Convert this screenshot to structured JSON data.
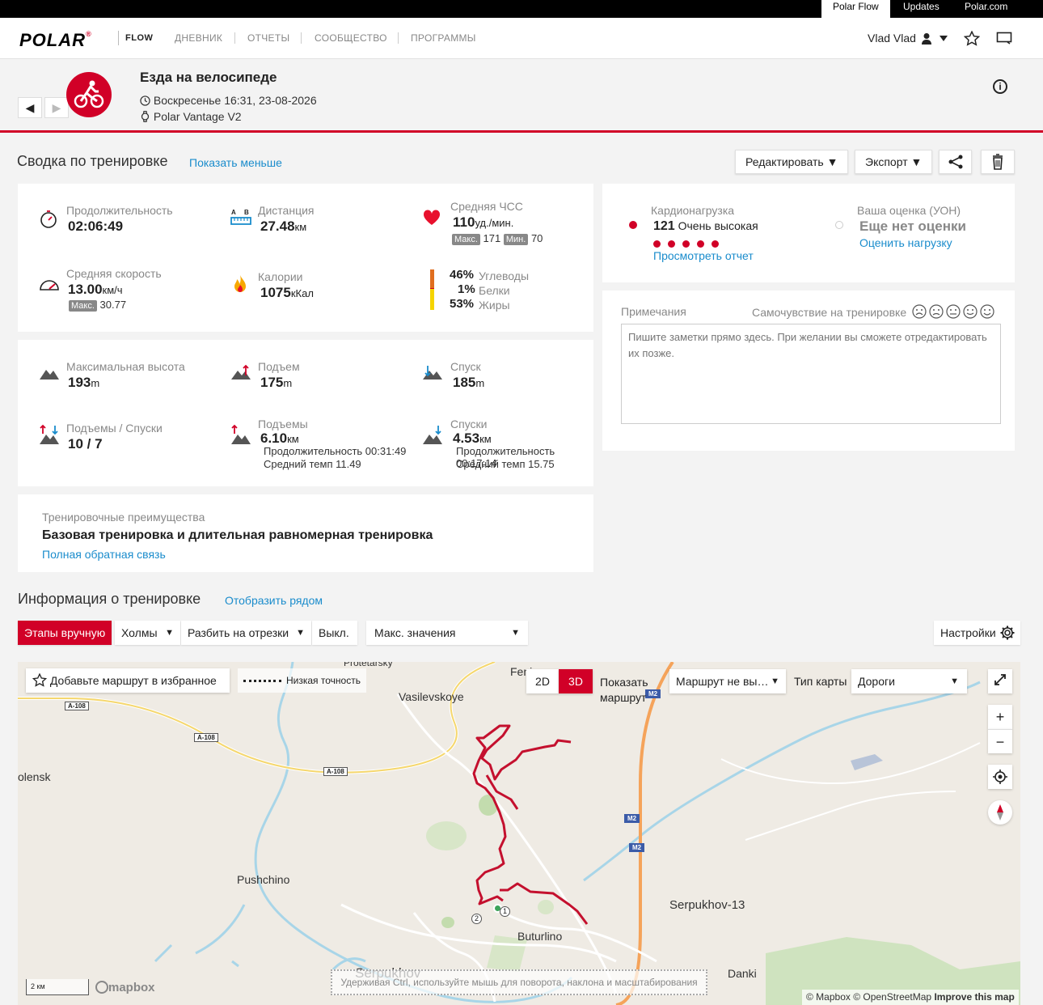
{
  "topbar": {
    "links": [
      "Polar Flow",
      "Updates",
      "Polar.com"
    ]
  },
  "nav": {
    "logo": "POLAR",
    "logo_mark": "®",
    "flow": "FLOW",
    "items": [
      "ДНЕВНИК",
      "ОТЧЕТЫ",
      "СООБЩЕСТВО",
      "ПРОГРАММЫ"
    ],
    "user": "Vlad Vlad"
  },
  "header": {
    "title": "Езда на велосипеде",
    "datetime": "Воскресенье 16:31, 23-08-2026",
    "device": "Polar Vantage V2"
  },
  "summary": {
    "title": "Сводка по тренировке",
    "show_less": "Показать меньше",
    "edit": "Редактировать",
    "export": "Экспорт"
  },
  "stats1": {
    "duration": {
      "label": "Продолжительность",
      "value": "02:06:49"
    },
    "distance": {
      "label": "Дистанция",
      "value": "27.48",
      "unit": "км"
    },
    "hr": {
      "label": "Средняя ЧСС",
      "value": "110",
      "unit": "уд./мин.",
      "max_label": "Макс.",
      "max": "171",
      "min_label": "Мин.",
      "min": "70"
    },
    "speed": {
      "label": "Средняя скорость",
      "value": "13.00",
      "unit": "км/ч",
      "max_label": "Макс.",
      "max": "30.77"
    },
    "calories": {
      "label": "Калории",
      "value": "1075",
      "unit": "кКал"
    },
    "carbs": {
      "value": "46%",
      "label": "Углеводы"
    },
    "protein": {
      "value": "1%",
      "label": "Белки"
    },
    "fat": {
      "value": "53%",
      "label": "Жиры"
    }
  },
  "stats2": {
    "max_alt": {
      "label": "Максимальная высота",
      "value": "193",
      "unit": "m"
    },
    "ascent": {
      "label": "Подъем",
      "value": "175",
      "unit": "m"
    },
    "descent": {
      "label": "Спуск",
      "value": "185",
      "unit": "m"
    },
    "updown": {
      "label": "Подъемы / Спуски",
      "value": "10 / 7"
    },
    "ups": {
      "label": "Подъемы",
      "value": "6.10",
      "unit": "км",
      "dur": "Продолжительность 00:31:49",
      "pace": "Средний темп 11.49"
    },
    "downs": {
      "label": "Спуски",
      "value": "4.53",
      "unit": "км",
      "dur": "Продолжительность 00:17:14",
      "pace": "Средний темп 15.75"
    }
  },
  "benefit": {
    "label": "Тренировочные преимущества",
    "text": "Базовая тренировка и длительная равномерная тренировка",
    "link": "Полная обратная связь"
  },
  "cardio": {
    "label": "Кардионагрузка",
    "value": "121",
    "desc": "Очень высокая",
    "dots": 5,
    "link": "Просмотреть отчет"
  },
  "rpe": {
    "label": "Ваша оценка (УОН)",
    "value": "Еще нет оценки",
    "link": "Оценить нагрузку"
  },
  "notes": {
    "label": "Примечания",
    "feel_label": "Самочувствие на тренировке",
    "placeholder": "Пишите заметки прямо здесь. При желании вы сможете отредактировать их позже."
  },
  "info": {
    "title": "Информация о тренировке",
    "side_link": "Отобразить рядом"
  },
  "tabs": {
    "laps": "Этапы вручную",
    "hills": "Холмы",
    "split": "Разбить на отрезки",
    "off": "Выкл.",
    "max": "Макс. значения",
    "settings": "Настройки"
  },
  "map": {
    "fav": "Добавьте маршрут в избранное",
    "precision": "Низкая точность",
    "d2": "2D",
    "d3": "3D",
    "show_route_1": "Показать",
    "show_route_2": "маршрут",
    "route_select": "Маршрут не вы…",
    "map_type_label": "Тип карты",
    "map_type": "Дороги",
    "zoom_in": "+",
    "zoom_out": "−",
    "places": [
      "Protetarsky",
      "Feni",
      "Vasilevskoye",
      "olensk",
      "Pushchino",
      "Serpukhov-13",
      "Buturlino",
      "Serpukhov",
      "Danki"
    ],
    "roads": [
      "A-108",
      "A-108",
      "A-108",
      "M2",
      "M2",
      "M2"
    ],
    "markers": [
      "1",
      "2"
    ],
    "hint": "Удерживая Ctrl, используйте мышь для поворота, наклона и масштабирования",
    "scale": "2 км",
    "mapbox": "mapbox",
    "attribution": "© Mapbox © OpenStreetMap",
    "improve": "Improve this map"
  }
}
